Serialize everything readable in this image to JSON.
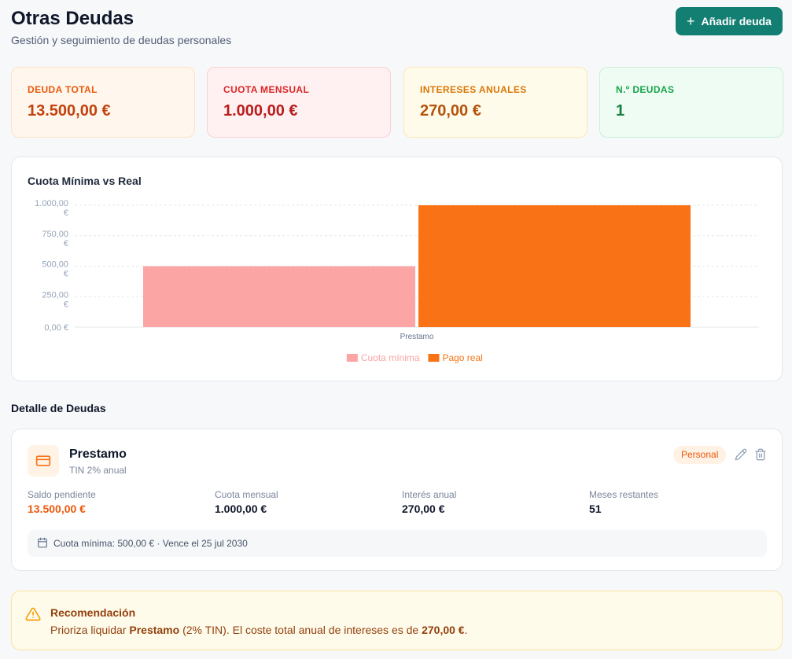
{
  "header": {
    "title": "Otras Deudas",
    "subtitle": "Gestión y seguimiento de deudas personales",
    "add_button": "Añadir deuda"
  },
  "stats": [
    {
      "label": "DEUDA TOTAL",
      "value": "13.500,00 €",
      "accent": "#ea580c"
    },
    {
      "label": "CUOTA MENSUAL",
      "value": "1.000,00 €",
      "accent": "#dc2626"
    },
    {
      "label": "INTERESES ANUALES",
      "value": "270,00 €",
      "accent": "#d97706"
    },
    {
      "label": "N.º DEUDAS",
      "value": "1",
      "accent": "#16a34a"
    }
  ],
  "chart": {
    "title": "Cuota Mínima vs Real"
  },
  "chart_data": {
    "type": "bar",
    "categories": [
      "Prestamo"
    ],
    "series": [
      {
        "name": "Cuota mínima",
        "values": [
          500
        ],
        "color": "#fca5a5"
      },
      {
        "name": "Pago real",
        "values": [
          1000
        ],
        "color": "#f97316"
      }
    ],
    "ylim": [
      0,
      1000
    ],
    "yticks": [
      0,
      250,
      500,
      750,
      1000
    ],
    "ytick_labels": [
      [
        "0,00 €"
      ],
      [
        "250,00",
        "€"
      ],
      [
        "500,00",
        "€"
      ],
      [
        "750,00",
        "€"
      ],
      [
        "1.000,00",
        "€"
      ]
    ],
    "grid": true,
    "legend": "bottom"
  },
  "details": {
    "section_title": "Detalle de Deudas",
    "debts": [
      {
        "name": "Prestamo",
        "subtitle": "TIN 2% anual",
        "badge": "Personal",
        "metrics": [
          {
            "label": "Saldo pendiente",
            "value": "13.500,00 €"
          },
          {
            "label": "Cuota mensual",
            "value": "1.000,00 €"
          },
          {
            "label": "Interés anual",
            "value": "270,00 €"
          },
          {
            "label": "Meses restantes",
            "value": "51"
          }
        ],
        "footer": "Cuota mínima: 500,00 € · Vence el 25 jul 2030"
      }
    ]
  },
  "recommendation": {
    "title": "Recomendación",
    "text_1": "Prioriza liquidar ",
    "debt_name": "Prestamo",
    "text_2": " (2% TIN). El coste total anual de intereses es de ",
    "amount": "270,00 €",
    "text_3": "."
  }
}
